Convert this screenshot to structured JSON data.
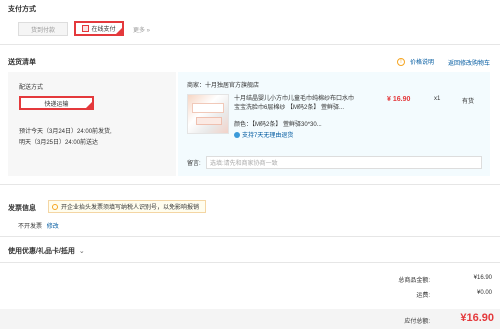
{
  "payment": {
    "title": "支付方式",
    "option_cod": "货到付款",
    "option_online": "在线支付",
    "more": "更多 »"
  },
  "delivery": {
    "title": "送货清单",
    "price_note": "价格说明",
    "back_to_cart": "返回修改购物车",
    "method_label": "配送方式",
    "method_value": "快递运输",
    "eta_today": "预计今天（3月24日）24:00前发货,",
    "eta_tomorrow": "明天（3月25日）24:00前送达"
  },
  "shop": {
    "label": "商家：",
    "name": "十月独居官方旗舰店"
  },
  "product": {
    "name_line1": "十月结晶婴儿小方巾儿童毛巾纯棉纱布口水巾",
    "name_line2": "宝宝洗脸巾6层棉纱 【M码2条】 萱鲜驿...",
    "price": "¥ 16.90",
    "qty": "x1",
    "stock": "有货",
    "color_label": "颜色：",
    "color_value": "【M码2条】 萱鲜驿30*30...",
    "return_policy": "支持7天无理由退货"
  },
  "memo": {
    "label": "留言:",
    "placeholder": "选填:请先和商家协商一致"
  },
  "invoice": {
    "title": "发票信息",
    "notice": "开企业抬头发票须填写纳税人识别号，以免影响报销",
    "value": "不开发票",
    "edit": "修改"
  },
  "coupon": {
    "title": "使用优惠/礼品卡/抵用"
  },
  "summary": {
    "total_label": "总商品金额:",
    "total_value": "¥16.90",
    "shipping_label": "运费:",
    "shipping_value": "¥0.00",
    "payable_label": "应付总额:",
    "payable_value": "¥16.90"
  },
  "colors": {
    "accent_red": "#e4393c",
    "link_blue": "#005aa0",
    "warning_orange": "#f6a623"
  }
}
